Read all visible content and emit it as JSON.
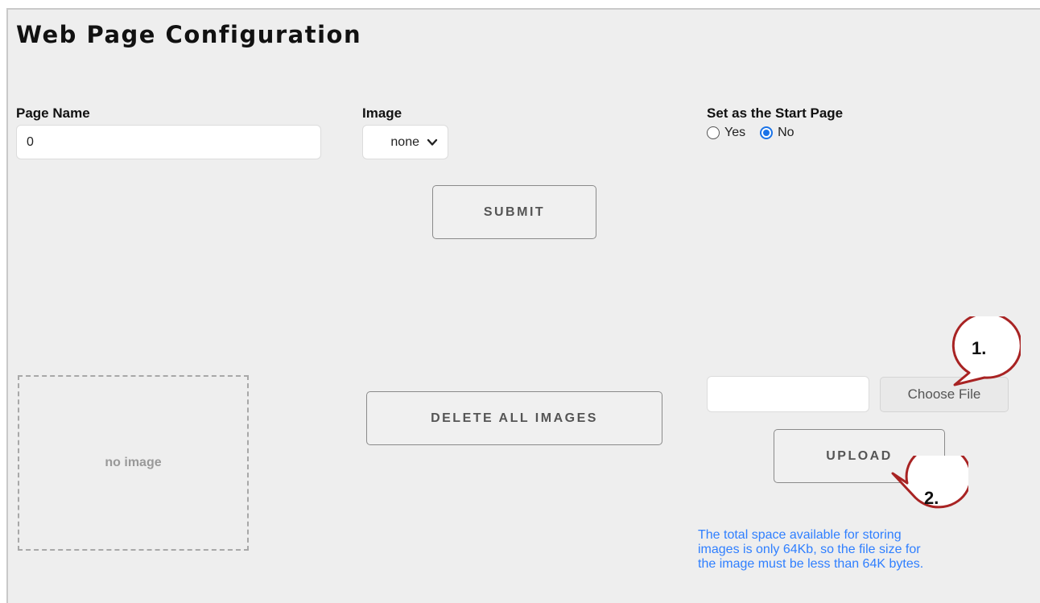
{
  "title": "Web Page Configuration",
  "page_name": {
    "label": "Page Name",
    "value": "0"
  },
  "image": {
    "label": "Image",
    "selected": "none"
  },
  "start_page": {
    "label": "Set as the Start Page",
    "options": [
      {
        "label": "Yes",
        "checked": false
      },
      {
        "label": "No",
        "checked": true
      }
    ]
  },
  "buttons": {
    "submit": "SUBMIT",
    "delete_all": "DELETE ALL IMAGES",
    "choose_file": "Choose File",
    "upload": "UPLOAD"
  },
  "preview": {
    "placeholder": "no image"
  },
  "note_lines": [
    "The total space available for storing",
    "images is only 64Kb, so the file size for",
    "the image must be less than 64K bytes."
  ],
  "callouts": [
    "1.",
    "2."
  ],
  "colors": {
    "accent": "#1a73e8",
    "note": "#2f7fff",
    "callout_border": "#a82323"
  }
}
